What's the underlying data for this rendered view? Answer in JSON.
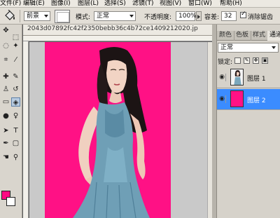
{
  "menubar": {
    "items": [
      "文件(F)",
      "编辑(E)",
      "图像(I)",
      "图层(L)",
      "选择(S)",
      "滤镜(T)",
      "视图(V)",
      "窗口(W)",
      "帮助(H)"
    ]
  },
  "options": {
    "tool_icon": "paint-bucket-icon",
    "fill_source": "前景",
    "mode_label": "模式:",
    "mode_value": "正常",
    "opacity_label": "不透明度:",
    "opacity_value": "100%",
    "tolerance_label": "容差:",
    "tolerance_value": "32",
    "antialias_label": "消除锯齿",
    "antialias_checked": true
  },
  "document": {
    "tab_title": "2043d07892fc42f2350bebb36c4b72ce1409212020.jp",
    "canvas_color": "#ff1185"
  },
  "toolbox": {
    "tools": [
      "move-icon",
      "marquee-icon",
      "lasso-icon",
      "magic-wand-icon",
      "crop-icon",
      "eyedropper-icon",
      "healing-brush-icon",
      "brush-icon",
      "clone-stamp-icon",
      "history-brush-icon",
      "eraser-icon",
      "paint-bucket-icon",
      "blur-icon",
      "dodge-icon",
      "path-select-icon",
      "type-icon",
      "pen-icon",
      "shape-icon",
      "hand-icon",
      "zoom-icon"
    ],
    "active_tool": "paint-bucket-icon",
    "foreground_color": "#ff0a82",
    "background_color": "#ffffff"
  },
  "panel": {
    "tabs": [
      "颜色",
      "色板",
      "样式",
      "通道"
    ],
    "blend_mode": "正常",
    "lock_label": "锁定:",
    "layers": [
      {
        "name": "图层 1",
        "selected": false
      },
      {
        "name": "图层 2",
        "selected": true
      }
    ]
  }
}
